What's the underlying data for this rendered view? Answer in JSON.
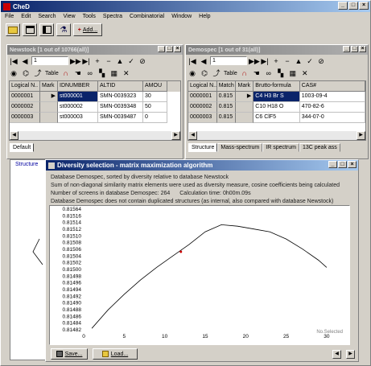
{
  "app": {
    "title": "CheD"
  },
  "menu": [
    "File",
    "Edit",
    "Search",
    "View",
    "Tools",
    "Spectra",
    "Combinatorial",
    "Window",
    "Help"
  ],
  "toolbar": {
    "add_label": "Add..."
  },
  "left_window": {
    "title": "Newstock [1 out of 10766(all)]",
    "record_input": "1",
    "table_label": "Table",
    "columns": [
      "Logical N..",
      "Mark",
      "IDNUMBER",
      "ALTID",
      "AMOU"
    ],
    "rows": [
      [
        "0000001",
        "▶",
        "st000001",
        "SMN-0039323",
        "30"
      ],
      [
        "0000002",
        "",
        "st000002",
        "SMN-0039348",
        "50"
      ],
      [
        "0000003",
        "",
        "st000003",
        "SMN-0039487",
        "0"
      ]
    ],
    "tabs": [
      "Default"
    ],
    "side_tab": "Structure"
  },
  "right_window": {
    "title": "Demospec [1 out of 31(all)]",
    "record_input": "1",
    "table_label": "Table",
    "columns": [
      "Logical N..",
      "Match",
      "Mark",
      "Brutto-formula",
      "CAS#"
    ],
    "rows": [
      [
        "0000001",
        "0.815",
        "▶",
        "C4 H3 Br S",
        "1003-09-4"
      ],
      [
        "0000002",
        "0.815",
        "",
        "C10 H18 O",
        "470-82-6"
      ],
      [
        "0000003",
        "0.815",
        "",
        "C6 ClF5",
        "344-07-0"
      ]
    ],
    "tabs": [
      "Structure",
      "Mass-spectrum",
      "IR spectrum",
      "13C peak ass"
    ]
  },
  "dialog": {
    "title": "Diversity selection - matrix maximization algorithm",
    "lines": [
      "Database Demospec, sorted by diversity relative to database Newstock",
      "Sum of non-diagonal similarity matrix elements were used as diversity measure, cosine coefficients being calculated",
      "Database Demospec does not contain duplicated structures (as internal, also compared with database Newstock)"
    ],
    "screens_label": "Number of screens in database Demospec: 264",
    "calc_label": "Calculation time:   0h00m.09s",
    "x_axis_label": "No.Selected",
    "save_label": "Save...",
    "load_label": "Load..."
  },
  "chart_data": {
    "type": "line",
    "x": [
      1,
      3,
      5,
      7,
      9,
      11,
      13,
      15,
      17,
      19,
      21,
      23,
      25,
      27,
      29,
      30
    ],
    "y": [
      0.81481,
      0.81494,
      0.81505,
      0.81515,
      0.81524,
      0.81532,
      0.8154,
      0.81549,
      0.81554,
      0.81553,
      0.81551,
      0.81549,
      0.81544,
      0.81537,
      0.81529,
      0.81524
    ],
    "marker": {
      "x": 12,
      "y": 0.81535
    },
    "xlim": [
      0,
      32
    ],
    "ylim": [
      0.8148,
      0.81565
    ],
    "x_ticks": [
      0,
      5,
      10,
      15,
      20,
      25,
      30
    ],
    "y_ticks": [
      "0.81564",
      "0.81516",
      "0.81514",
      "0.81512",
      "0.81510",
      "0.81508",
      "0.81506",
      "0.81504",
      "0.81502",
      "0.81500",
      "0.81498",
      "0.81496",
      "0.81494",
      "0.81492",
      "0.81490",
      "0.81488",
      "0.81486",
      "0.81484",
      "0.81482"
    ],
    "line_color": "#000000",
    "marker_color": "#cc0000"
  }
}
